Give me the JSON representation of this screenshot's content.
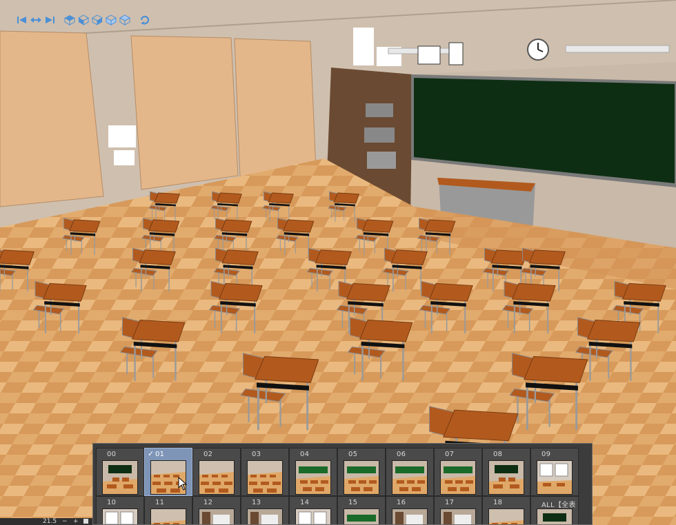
{
  "toolbar": {
    "buttons": [
      {
        "id": "go-first",
        "icon": "skip-back-icon"
      },
      {
        "id": "pan",
        "icon": "pan-arrows-icon"
      },
      {
        "id": "go-last",
        "icon": "skip-forward-icon"
      },
      {
        "id": "view-top",
        "icon": "cube-top-icon"
      },
      {
        "id": "view-front",
        "icon": "cube-front-icon"
      },
      {
        "id": "view-side",
        "icon": "cube-side-icon"
      },
      {
        "id": "view-back",
        "icon": "cube-back-icon"
      },
      {
        "id": "view-bottom",
        "icon": "cube-bottom-icon"
      },
      {
        "id": "rotate",
        "icon": "rotate-icon"
      }
    ]
  },
  "scene_panel": {
    "selected_index": 1,
    "selected_mark": "✓",
    "items": [
      {
        "label": "00",
        "scene": "front"
      },
      {
        "label": "01",
        "scene": "rows"
      },
      {
        "label": "02",
        "scene": "rows"
      },
      {
        "label": "03",
        "scene": "rows"
      },
      {
        "label": "04",
        "scene": "board"
      },
      {
        "label": "05",
        "scene": "board"
      },
      {
        "label": "06",
        "scene": "board"
      },
      {
        "label": "07",
        "scene": "board"
      },
      {
        "label": "08",
        "scene": "front"
      },
      {
        "label": "09",
        "scene": "window"
      },
      {
        "label": "10",
        "scene": "window"
      },
      {
        "label": "11",
        "scene": "rows"
      },
      {
        "label": "12",
        "scene": "door"
      },
      {
        "label": "13",
        "scene": "door"
      },
      {
        "label": "14",
        "scene": "window"
      },
      {
        "label": "15",
        "scene": "board"
      },
      {
        "label": "16",
        "scene": "door"
      },
      {
        "label": "17",
        "scene": "door"
      },
      {
        "label": "18",
        "scene": "rows"
      },
      {
        "label": "ALL【全表示】",
        "scene": "front"
      }
    ]
  },
  "status": {
    "zoom": "21.5",
    "minus": "−",
    "plus": "+"
  },
  "colors": {
    "wall": "#c9b9a8",
    "floor": "#e0a868",
    "desk_top": "#b25a1e",
    "chalkboard": "#0e2e14",
    "panel_bg": "#3c3c3c",
    "selected_thumb": "#7e95b8",
    "toolbar_icon": "#4a8fd8"
  }
}
